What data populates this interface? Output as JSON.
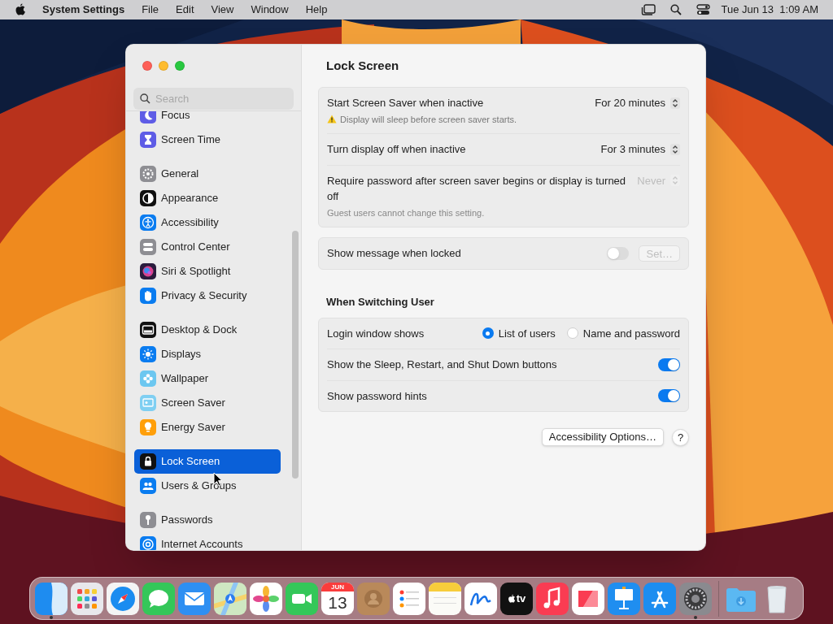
{
  "menu_bar": {
    "app_name": "System Settings",
    "menus": [
      "File",
      "Edit",
      "View",
      "Window",
      "Help"
    ],
    "clock": "Tue Jun 13  1:09 AM"
  },
  "window": {
    "search": {
      "placeholder": "Search"
    },
    "sidebar": {
      "groups": [
        {
          "items": [
            {
              "label": "Focus",
              "kind": "focus",
              "selected": false
            },
            {
              "label": "Screen Time",
              "kind": "screen_time",
              "selected": false
            }
          ]
        },
        {
          "items": [
            {
              "label": "General",
              "kind": "general",
              "selected": false
            },
            {
              "label": "Appearance",
              "kind": "appearance",
              "selected": false
            },
            {
              "label": "Accessibility",
              "kind": "accessibility",
              "selected": false
            },
            {
              "label": "Control Center",
              "kind": "control_center",
              "selected": false
            },
            {
              "label": "Siri & Spotlight",
              "kind": "siri",
              "selected": false
            },
            {
              "label": "Privacy & Security",
              "kind": "privacy",
              "selected": false
            }
          ]
        },
        {
          "items": [
            {
              "label": "Desktop & Dock",
              "kind": "desktop",
              "selected": false
            },
            {
              "label": "Displays",
              "kind": "displays",
              "selected": false
            },
            {
              "label": "Wallpaper",
              "kind": "wallpaper",
              "selected": false
            },
            {
              "label": "Screen Saver",
              "kind": "screen_saver",
              "selected": false
            },
            {
              "label": "Energy Saver",
              "kind": "energy",
              "selected": false
            }
          ]
        },
        {
          "items": [
            {
              "label": "Lock Screen",
              "kind": "lock",
              "selected": true
            },
            {
              "label": "Users & Groups",
              "kind": "users",
              "selected": false
            }
          ]
        },
        {
          "items": [
            {
              "label": "Passwords",
              "kind": "passwords",
              "selected": false
            },
            {
              "label": "Internet Accounts",
              "kind": "internet",
              "selected": false
            }
          ]
        }
      ]
    },
    "title": "Lock Screen",
    "sections": [
      {
        "rows": [
          {
            "kind": "popup",
            "label": "Start Screen Saver when inactive",
            "warning": "Display will sleep before screen saver starts.",
            "value": "For 20 minutes",
            "disabled": false
          },
          {
            "kind": "popup",
            "label": "Turn display off when inactive",
            "value": "For 3 minutes",
            "disabled": false
          },
          {
            "kind": "popup",
            "label": "Require password after screen saver begins or display is turned off",
            "note": "Guest users cannot change this setting.",
            "value": "Never",
            "disabled": true
          }
        ]
      },
      {
        "rows": [
          {
            "kind": "toggle_button",
            "label": "Show message when locked",
            "on": false,
            "button": "Set…",
            "button_disabled": true
          }
        ]
      },
      {
        "header": "When Switching User",
        "rows": [
          {
            "kind": "radio",
            "label": "Login window shows",
            "options": [
              {
                "label": "List of users",
                "selected": true
              },
              {
                "label": "Name and password",
                "selected": false
              }
            ]
          },
          {
            "kind": "toggle",
            "label": "Show the Sleep, Restart, and Shut Down buttons",
            "on": true
          },
          {
            "kind": "toggle",
            "label": "Show password hints",
            "on": true
          }
        ]
      }
    ],
    "buttons": [
      {
        "kind": "text",
        "label": "Accessibility Options…"
      },
      {
        "kind": "help",
        "label": "?"
      }
    ]
  },
  "dock": {
    "items": [
      {
        "kind": "finder",
        "running": true
      },
      {
        "kind": "launchpad",
        "running": false
      },
      {
        "kind": "safari",
        "running": false
      },
      {
        "kind": "messages",
        "running": false
      },
      {
        "kind": "mail",
        "running": false
      },
      {
        "kind": "maps",
        "running": false
      },
      {
        "kind": "photos",
        "running": false
      },
      {
        "kind": "facetime",
        "running": false
      },
      {
        "kind": "calendar",
        "month": "JUN",
        "day": "13",
        "running": false
      },
      {
        "kind": "contacts",
        "running": false
      },
      {
        "kind": "reminders",
        "running": false
      },
      {
        "kind": "notes",
        "running": false
      },
      {
        "kind": "freeform",
        "running": false
      },
      {
        "kind": "tv",
        "label": "tv",
        "running": false
      },
      {
        "kind": "music",
        "running": false
      },
      {
        "kind": "news",
        "running": false
      },
      {
        "kind": "keynote",
        "running": false
      },
      {
        "kind": "appstore",
        "running": false
      },
      {
        "kind": "settings",
        "running": true
      },
      {
        "kind": "separator"
      },
      {
        "kind": "downloads",
        "running": false
      },
      {
        "kind": "trash",
        "running": false
      }
    ]
  }
}
